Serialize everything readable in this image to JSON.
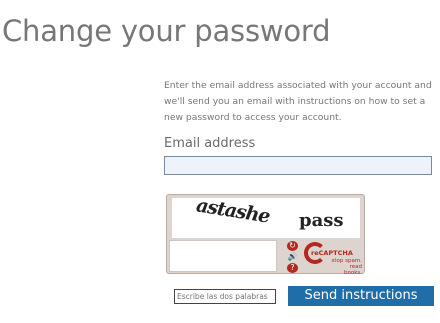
{
  "page": {
    "title": "Change your password",
    "intro": "Enter the email address associated with your account and we'll send you an email with instructions on how to set a new password to access your account."
  },
  "form": {
    "email_label": "Email address",
    "email_value": "",
    "send_label": "Send instructions"
  },
  "captcha": {
    "word1": "astashe",
    "word2": "pass",
    "input_placeholder": "Escribe las dos palabras",
    "brand": "reCAPTCHA",
    "slogan": "stop spam. read books.",
    "controls": [
      "reload-icon",
      "audio-icon",
      "help-icon"
    ],
    "accent_color": "#b3281f"
  },
  "colors": {
    "button": "#1f6ea8",
    "input_bg": "#eef2fa"
  }
}
